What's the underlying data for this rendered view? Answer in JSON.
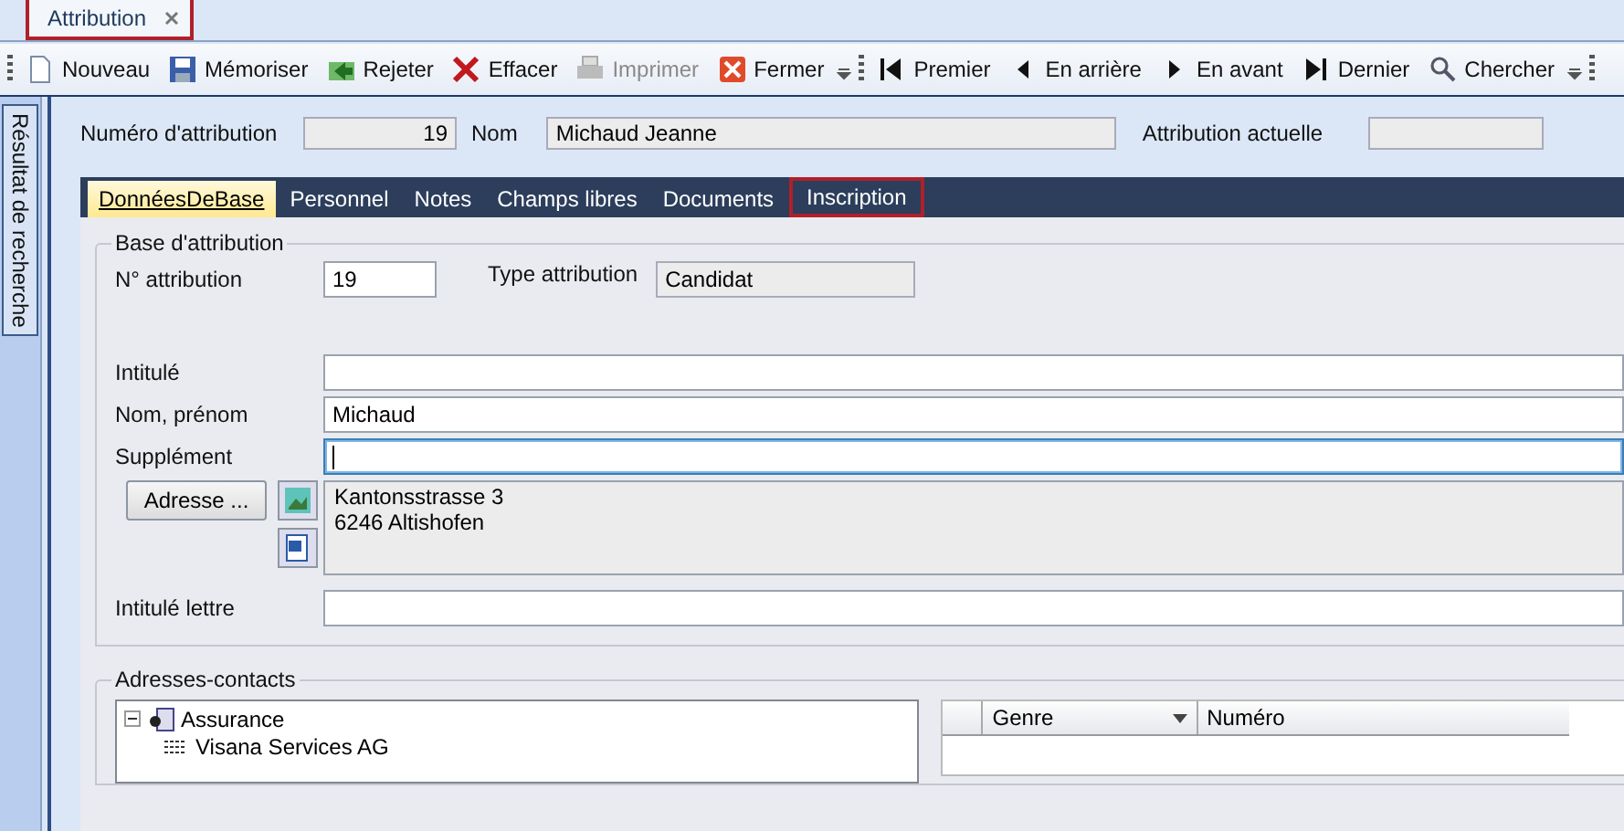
{
  "document_tabs": [
    {
      "label": "Attribution",
      "selected": true,
      "highlighted": true
    }
  ],
  "toolbar": [
    {
      "kind": "grip"
    },
    {
      "kind": "button",
      "label": "Nouveau",
      "disabled": false
    },
    {
      "kind": "button",
      "label": "Mémoriser",
      "disabled": false
    },
    {
      "kind": "button",
      "label": "Rejeter",
      "disabled": false
    },
    {
      "kind": "button",
      "label": "Effacer",
      "disabled": false
    },
    {
      "kind": "button",
      "label": "Imprimer",
      "disabled": true
    },
    {
      "kind": "button",
      "label": "Fermer",
      "disabled": false
    },
    {
      "kind": "overflow"
    },
    {
      "kind": "grip"
    },
    {
      "kind": "button",
      "label": "Premier",
      "disabled": false
    },
    {
      "kind": "button",
      "label": "En arrière",
      "disabled": false
    },
    {
      "kind": "button",
      "label": "En avant",
      "disabled": false
    },
    {
      "kind": "button",
      "label": "Dernier",
      "disabled": false
    },
    {
      "kind": "button",
      "label": "Chercher",
      "disabled": false
    },
    {
      "kind": "overflow"
    },
    {
      "kind": "grip"
    }
  ],
  "sidebar": {
    "label": "Résultat de recherche"
  },
  "header": {
    "number_label": "Numéro d'attribution",
    "number": "19",
    "name_label": "Nom",
    "name": "Michaud Jeanne",
    "current_label": "Attribution actuelle"
  },
  "tabs": [
    {
      "label": "DonnéesDeBase",
      "selected": true,
      "highlighted": false
    },
    {
      "label": "Personnel",
      "selected": false,
      "highlighted": false
    },
    {
      "label": "Notes",
      "selected": false,
      "highlighted": false
    },
    {
      "label": "Champs libres",
      "selected": false,
      "highlighted": false
    },
    {
      "label": "Documents",
      "selected": false,
      "highlighted": false
    },
    {
      "label": "Inscription",
      "selected": false,
      "highlighted": true
    }
  ],
  "base": {
    "title": "Base d'attribution",
    "number_label": "N° attribution",
    "number": "19",
    "type_label": "Type attribution",
    "type": "Candidat",
    "fields": [
      {
        "label": "Intitulé",
        "focused": false
      },
      {
        "label": "Nom, prénom",
        "value": "Michaud",
        "focused": false
      },
      {
        "label": "Supplément",
        "focused": true
      }
    ],
    "address_button": "Adresse ...",
    "address": [
      "Kantonsstrasse 3",
      "6246 Altishofen"
    ],
    "letter_label": "Intitulé lettre"
  },
  "contacts": {
    "title": "Adresses-contacts",
    "tree": [
      {
        "label": "Assurance",
        "expanded": true,
        "children": [
          {
            "label": "Visana Services AG"
          }
        ]
      }
    ],
    "columns": [
      "Genre",
      "Numéro"
    ]
  }
}
